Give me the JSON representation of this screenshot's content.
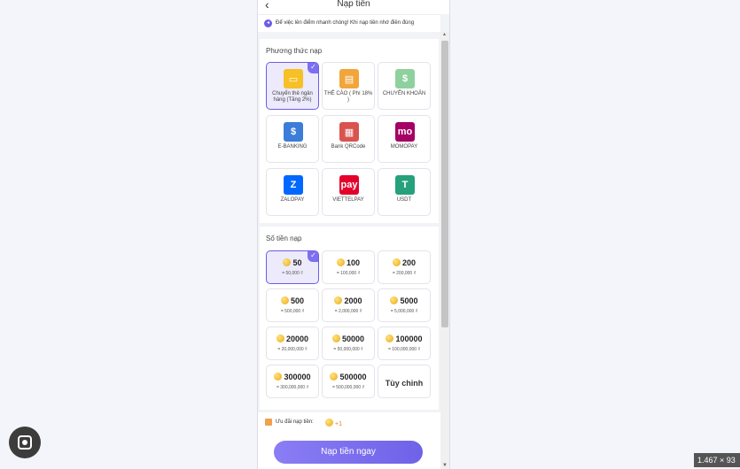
{
  "header": {
    "back_icon": "‹",
    "title": "Nạp tiền"
  },
  "notice": {
    "icon": "◂",
    "text": "Để việc lên điểm nhanh chóng! Khi nạp tiền nhớ điền đúng"
  },
  "methods": {
    "title": "Phương thức nạp",
    "items": [
      {
        "label": "Chuyển thẻ ngân hàng (Tăng 2%)",
        "icon": "bank-card-icon",
        "glyph": "▭",
        "color": "#f6c026",
        "selected": true
      },
      {
        "label": "THẺ CÀO ( Phí 18% )",
        "icon": "scratch-card-icon",
        "glyph": "▤",
        "color": "#f2a53a",
        "selected": false
      },
      {
        "label": "CHUYỂN KHOẢN",
        "icon": "transfer-icon",
        "glyph": "$",
        "color": "#8fd19e",
        "selected": false
      },
      {
        "label": "E-BANKING",
        "icon": "ebanking-icon",
        "glyph": "$",
        "color": "#3b7dd8",
        "selected": false
      },
      {
        "label": "Bank QRCode",
        "icon": "qr-code-icon",
        "glyph": "▦",
        "color": "#d9534f",
        "selected": false
      },
      {
        "label": "MOMOPAY",
        "icon": "momo-icon",
        "glyph": "mo",
        "color": "#a50064",
        "selected": false
      },
      {
        "label": "ZALOPAY",
        "icon": "zalopay-icon",
        "glyph": "Z",
        "color": "#0068ff",
        "selected": false
      },
      {
        "label": "VIETTELPAY",
        "icon": "viettelpay-icon",
        "glyph": "pay",
        "color": "#e4002b",
        "selected": false
      },
      {
        "label": "USDT",
        "icon": "usdt-icon",
        "glyph": "T",
        "color": "#26a17b",
        "selected": false
      }
    ]
  },
  "amounts": {
    "title": "Số tiền nạp",
    "items": [
      {
        "value": "50",
        "sub": "= 50,000 ₫",
        "selected": true
      },
      {
        "value": "100",
        "sub": "= 100,000 ₫",
        "selected": false
      },
      {
        "value": "200",
        "sub": "= 200,000 ₫",
        "selected": false
      },
      {
        "value": "500",
        "sub": "= 500,000 ₫",
        "selected": false
      },
      {
        "value": "2000",
        "sub": "= 2,000,000 ₫",
        "selected": false
      },
      {
        "value": "5000",
        "sub": "= 5,000,000 ₫",
        "selected": false
      },
      {
        "value": "20000",
        "sub": "= 20,000,000 ₫",
        "selected": false
      },
      {
        "value": "50000",
        "sub": "= 50,000,000 ₫",
        "selected": false
      },
      {
        "value": "100000",
        "sub": "= 100,000,000 ₫",
        "selected": false
      },
      {
        "value": "300000",
        "sub": "= 300,000,000 ₫",
        "selected": false
      },
      {
        "value": "500000",
        "sub": "= 500,000,000 ₫",
        "selected": false
      }
    ],
    "custom_label": "Tùy chỉnh"
  },
  "promo": {
    "label": "Ưu đãi nạp tiền:",
    "value": "+1"
  },
  "cta": {
    "label": "Nạp tiền ngay"
  },
  "scrollbar": {
    "up": "▲",
    "down": "▼"
  },
  "check_glyph": "✓",
  "zoom_badge": "1.467 × 93",
  "colors": {
    "accent": "#6c5ce7",
    "selected_bg": "#eceafb",
    "cta_start": "#8a7df4",
    "cta_end": "#6f62e8"
  }
}
